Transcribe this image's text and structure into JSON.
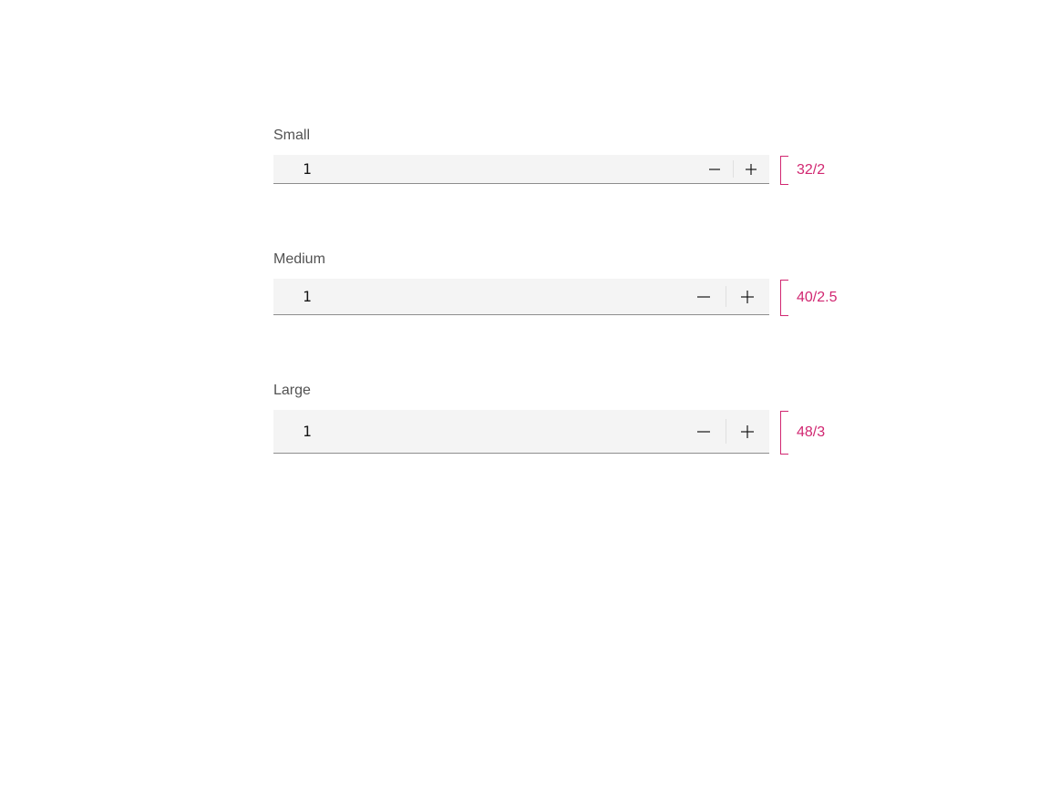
{
  "colors": {
    "accent": "#d12771",
    "field_bg": "#f4f4f4",
    "border": "#8d8d8d"
  },
  "small": {
    "label": "Small",
    "value": "1",
    "dim": "32/2"
  },
  "medium": {
    "label": "Medium",
    "value": "1",
    "dim": "40/2.5"
  },
  "large": {
    "label": "Large",
    "value": "1",
    "dim": "48/3"
  }
}
